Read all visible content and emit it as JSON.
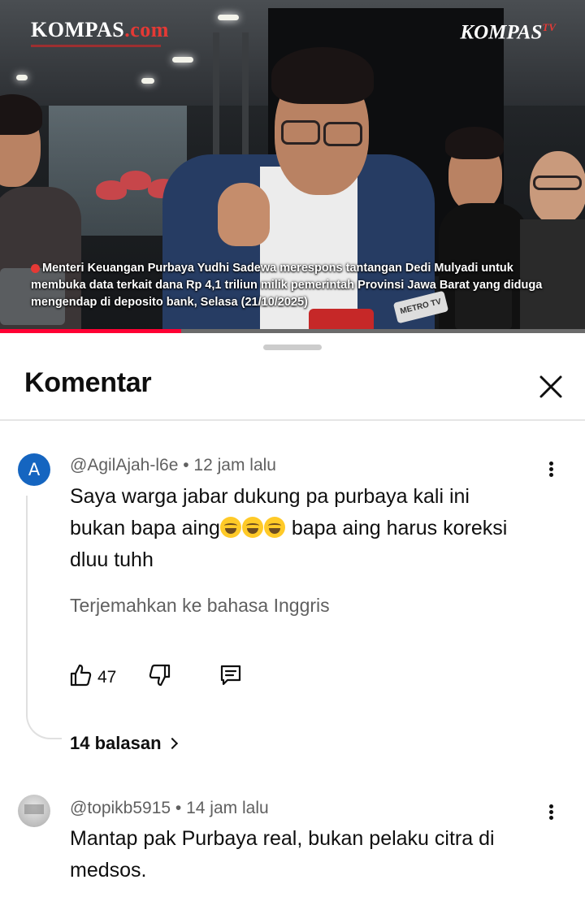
{
  "video": {
    "logo_left_main": "KOMPAS",
    "logo_left_suffix": ".com",
    "logo_right_main": "KOMPAS",
    "logo_right_suffix": "TV",
    "caption": "Menteri Keuangan Purbaya Yudhi Sadewa merespons tantangan Dedi Mulyadi untuk membuka data terkait dana Rp 4,1 triliun milik pemerintah Provinsi Jawa Barat yang diduga mengendap di deposito bank, Selasa (21/10/2025)",
    "mic_badge": "METRO TV",
    "progress_fraction": 0.31,
    "accent_color": "#ff0033"
  },
  "sheet": {
    "title": "Komentar",
    "close_icon": "close-icon"
  },
  "comments": [
    {
      "avatar_letter": "A",
      "avatar_color": "#1565c0",
      "author": "@AgilAjah-l6e",
      "time": "12 jam lalu",
      "text_line1": "Saya warga jabar dukung pa purbaya kali ini",
      "text_line2_before": "bukan bapa aing",
      "text_line2_after": " bapa aing harus koreksi",
      "text_line3": "dluu tuhh",
      "emoji_count": 3,
      "translate_label": "Terjemahkan ke bahasa Inggris",
      "like_count": "47",
      "replies_label": "14 balasan"
    },
    {
      "author": "@topikb5915",
      "time": "14 jam lalu",
      "text_line1": "Mantap pak Purbaya real, bukan pelaku citra di",
      "text_line2": "medsos."
    }
  ]
}
